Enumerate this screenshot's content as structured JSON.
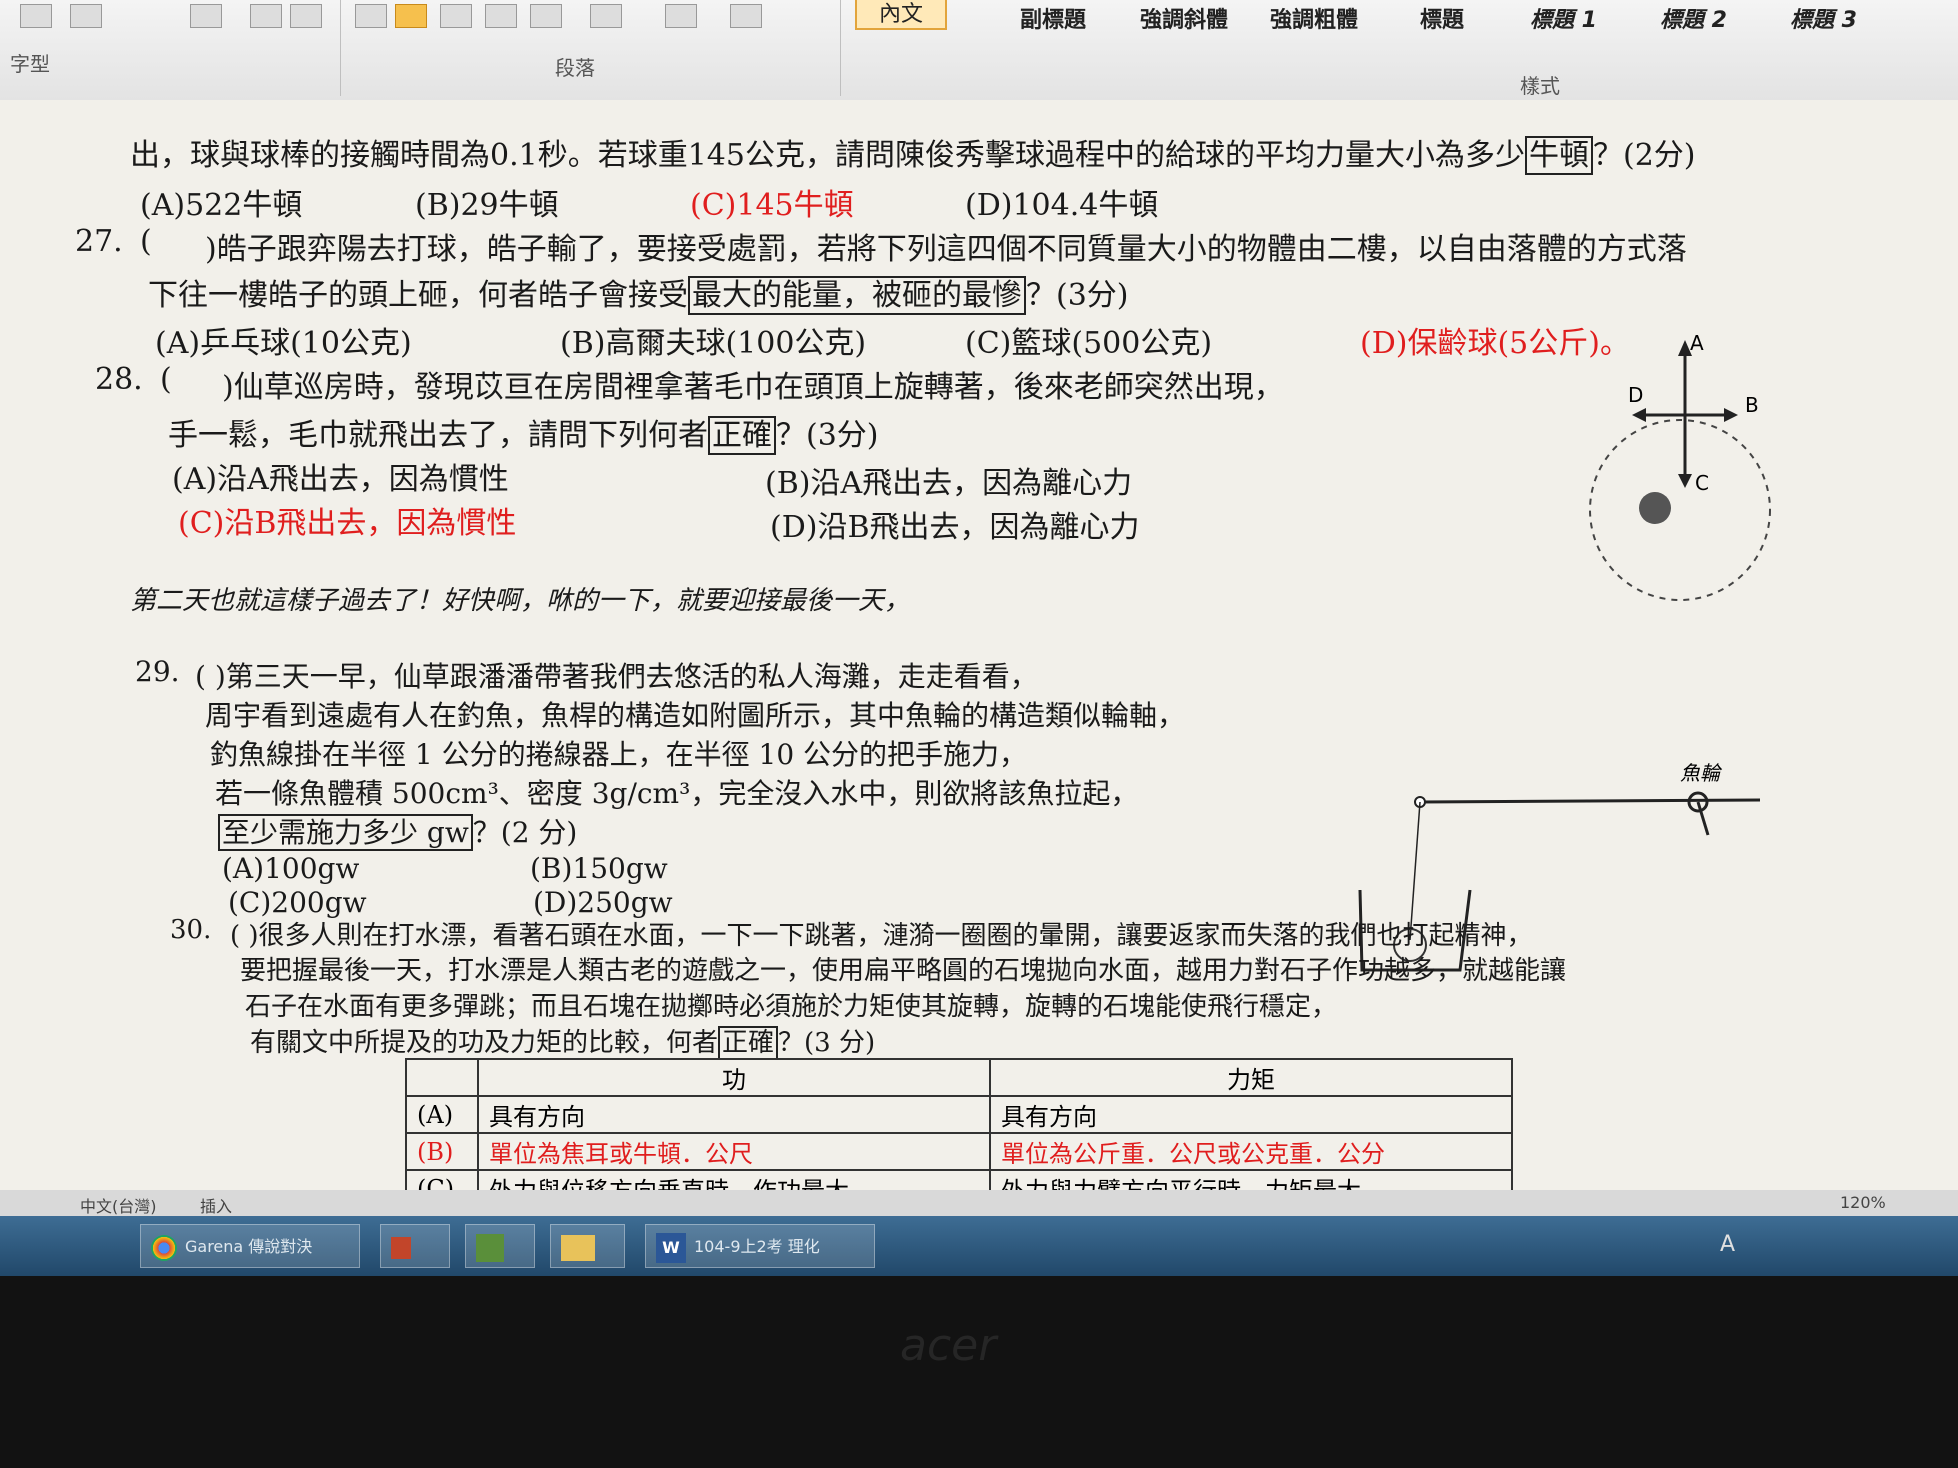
{
  "ribbon": {
    "group_font": "字型",
    "group_paragraph": "段落",
    "group_styles": "樣式",
    "styles": [
      "內文",
      "副標題",
      "強調斜體",
      "強調粗體",
      "標題",
      "標題 1",
      "標題 2",
      "標題 3"
    ]
  },
  "q26": {
    "line_partial": "出，球與球棒的接觸時間為0.1秒。若球重145公克，請問陳俊秀擊球過程中的給球的平均力量大小為多少",
    "box": "牛頓",
    "end": "？(2分)",
    "options": [
      "(A)522牛頓",
      "(B)29牛頓",
      "(C)145牛頓",
      "(D)104.4牛頓"
    ]
  },
  "q27": {
    "num": "27.",
    "paren": "(",
    "line1": ")皓子跟弈陽去打球，皓子輸了，要接受處罰，若將下列這四個不同質量大小的物體由二樓，以自由落體的方式落",
    "line2_pre": "下往一樓皓子的頭上砸，何者皓子會接受",
    "box": "最大的能量，被砸的最慘",
    "end": "？(3分)",
    "options": [
      "(A)乒乓球(10公克)",
      "(B)高爾夫球(100公克)",
      "(C)籃球(500公克)",
      "(D)保齡球(5公斤)。"
    ]
  },
  "q28": {
    "num": "28.",
    "paren": "(",
    "line1": ")仙草巡房時，發現苡亘在房間裡拿著毛巾在頭頂上旋轉著，後來老師突然出現，",
    "line2_pre": "手一鬆，毛巾就飛出去了，請問下列何者",
    "box": "正確",
    "end": "？(3分)",
    "options": [
      "(A)沿A飛出去，因為慣性",
      "(B)沿A飛出去，因為離心力",
      "(C)沿B飛出去，因為慣性",
      "(D)沿B飛出去，因為離心力"
    ],
    "diagram_labels": [
      "A",
      "B",
      "C",
      "D"
    ]
  },
  "interlude": "第二天也就這樣子過去了！好快啊，咻的一下，就要迎接最後一天，",
  "q29": {
    "num": "29.",
    "line1": "(  )第三天一早，仙草跟潘潘帶著我們去悠活的私人海灘，走走看看，",
    "line2": "周宇看到遠處有人在釣魚，魚桿的構造如附圖所示，其中魚輪的構造類似輪軸，",
    "line3": "釣魚線掛在半徑 1 公分的捲線器上，在半徑 10 公分的把手施力，",
    "line4": "若一條魚體積 500cm³、密度 3g/cm³，完全沒入水中，則欲將該魚拉起，",
    "box": "至少需施力多少 gw",
    "end": "？(2 分)",
    "options": [
      "(A)100gw",
      "(B)150gw",
      "(C)200gw",
      "(D)250gw"
    ],
    "diagram_label": "魚輪"
  },
  "q30": {
    "num": "30.",
    "line1": "(   )很多人則在打水漂，看著石頭在水面，一下一下跳著，漣漪一圈圈的暈開，讓要返家而失落的我們也打起精神，",
    "line2": "要把握最後一天，打水漂是人類古老的遊戲之一，使用扁平略圓的石塊拋向水面，越用力對石子作功越多，就越能讓",
    "line3": "石子在水面有更多彈跳；而且石塊在拋擲時必須施於力矩使其旋轉，旋轉的石塊能使飛行穩定，",
    "line4_pre": "有關文中所提及的功及力矩的比較，何者",
    "box": "正確",
    "end": "？(3 分)",
    "table_headers": [
      "",
      "功",
      "力矩"
    ],
    "rows": [
      [
        "(A)",
        "具有方向",
        "具有方向"
      ],
      [
        "(B)",
        "單位為焦耳或牛頓．公尺",
        "單位為公斤重．公尺或公克重．公分"
      ],
      [
        "(C)",
        "外力與位移方向垂直時，作功最大",
        "外力與力臂方向平行時，力矩最大"
      ]
    ]
  },
  "statusbar": {
    "lang": "中文(台灣)",
    "mode": "插入",
    "zoom": "120%"
  },
  "taskbar": {
    "items": [
      "Garena 傳說對決",
      "104-9上2考 理化"
    ],
    "tray": "A"
  },
  "monitor_brand": "acer",
  "colors": {
    "answer_red": "#e01e1e",
    "taskbar": "#2e5a80",
    "ribbon_selected": "#f6c04d"
  }
}
